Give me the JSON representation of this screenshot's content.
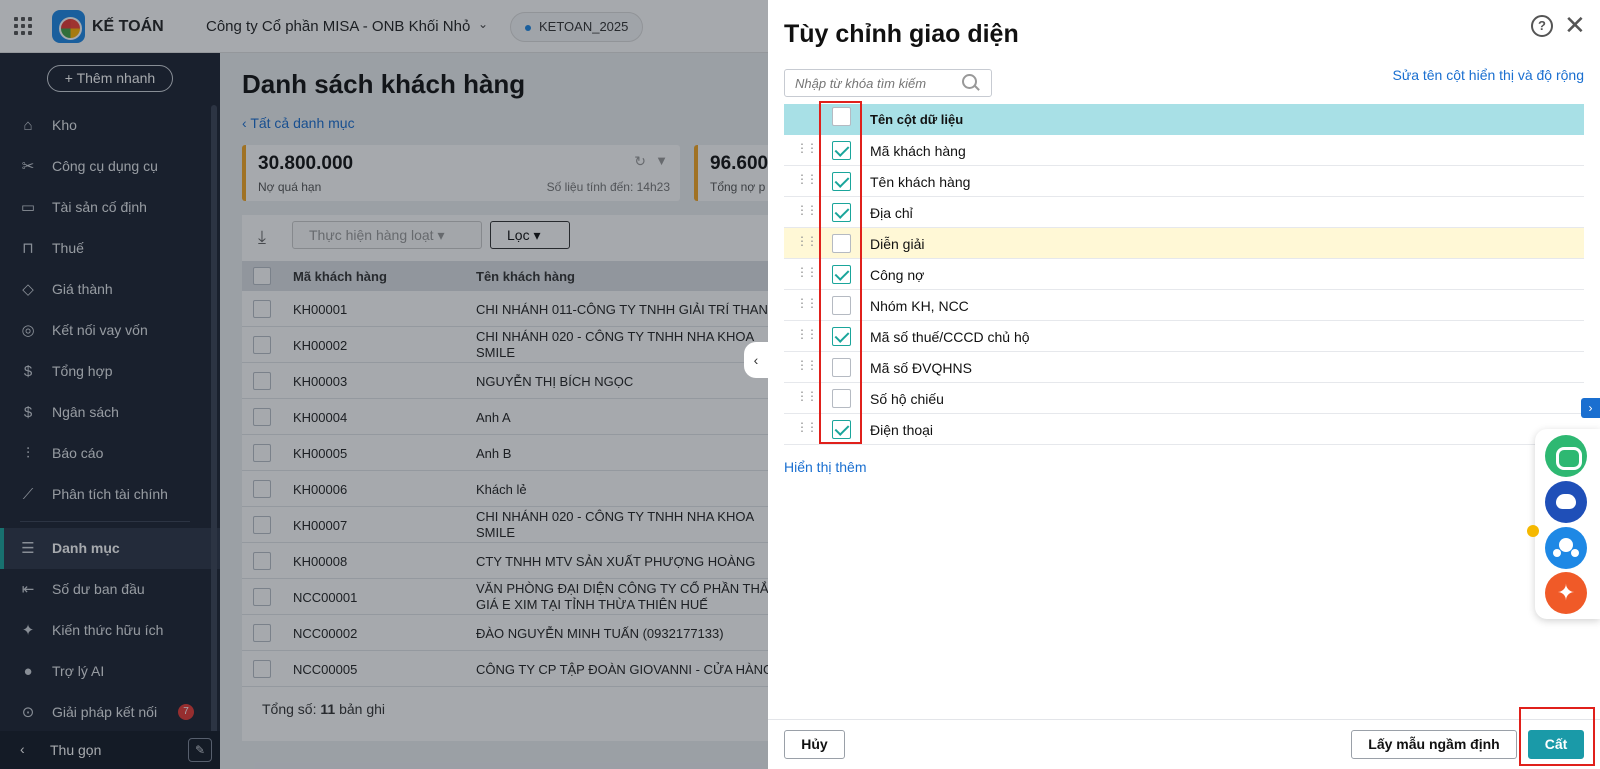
{
  "topbar": {
    "app_name": "KẾ TOÁN",
    "company": "Công ty Cổ phần MISA - ONB Khối Nhỏ",
    "database": "KETOAN_2025"
  },
  "sidebar": {
    "quick_add": "Thêm nhanh",
    "items": [
      {
        "label": "Kho",
        "icon": "warehouse-icon",
        "glyph": "⌂"
      },
      {
        "label": "Công cụ dụng cụ",
        "icon": "tools-icon",
        "glyph": "✂"
      },
      {
        "label": "Tài sản cố định",
        "icon": "car-icon",
        "glyph": "▭"
      },
      {
        "label": "Thuế",
        "icon": "bank-icon",
        "glyph": "⊓"
      },
      {
        "label": "Giá thành",
        "icon": "tag-icon",
        "glyph": "◇"
      },
      {
        "label": "Kết nối vay vốn",
        "icon": "globe-icon",
        "glyph": "◎"
      },
      {
        "label": "Tổng hợp",
        "icon": "ledger-icon",
        "glyph": "$"
      },
      {
        "label": "Ngân sách",
        "icon": "budget-icon",
        "glyph": "$"
      },
      {
        "label": "Báo cáo",
        "icon": "bar-chart-icon",
        "glyph": "⫶"
      },
      {
        "label": "Phân tích tài chính",
        "icon": "line-chart-icon",
        "glyph": "⟋"
      }
    ],
    "items2": [
      {
        "label": "Danh mục",
        "icon": "list-icon",
        "glyph": "☰"
      },
      {
        "label": "Số dư ban đầu",
        "icon": "opening-balance-icon",
        "glyph": "⇤"
      },
      {
        "label": "Kiến thức hữu ích",
        "icon": "knowledge-icon",
        "glyph": "✦"
      },
      {
        "label": "Trợ lý AI",
        "icon": "ai-assistant-icon",
        "glyph": "●"
      },
      {
        "label": "Giải pháp kết nối",
        "icon": "location-icon",
        "glyph": "⊙"
      }
    ],
    "badge": "7",
    "collapse": "Thu gọn"
  },
  "main": {
    "title": "Danh sách khách hàng",
    "back": "Tất cả danh mục",
    "card1": {
      "amount": "30.800.000",
      "label": "Nợ quá hạn",
      "updated": "Số liệu tính đến: 14h23"
    },
    "card2": {
      "amount": "96.600",
      "label": "Tổng nợ p"
    },
    "toolbar": {
      "bulk": "Thực hiện hàng loạt",
      "filter": "Lọc"
    },
    "columns": {
      "code": "Mã khách hàng",
      "name": "Tên khách hàng"
    },
    "rows": [
      {
        "code": "KH00001",
        "name": "CHI NHÁNH 011-CÔNG TY TNHH GIẢI TRÍ THAN"
      },
      {
        "code": "KH00002",
        "name": "CHI NHÁNH 020 - CÔNG TY TNHH NHA KHOA SMILE"
      },
      {
        "code": "KH00003",
        "name": "NGUYỄN THỊ BÍCH NGỌC"
      },
      {
        "code": "KH00004",
        "name": "Anh A"
      },
      {
        "code": "KH00005",
        "name": "Anh B"
      },
      {
        "code": "KH00006",
        "name": "Khách lẻ"
      },
      {
        "code": "KH00007",
        "name": "CHI NHÁNH 020 - CÔNG TY TNHH NHA KHOA SMILE"
      },
      {
        "code": "KH00008",
        "name": "CTY TNHH MTV SẢN XUẤT PHƯỢNG HOÀNG"
      },
      {
        "code": "NCC00001",
        "name": "VĂN PHÒNG ĐẠI DIỆN CÔNG TY CỔ PHẦN THẮ GIÁ E XIM TẠI TỈNH THỪA THIÊN HUẾ"
      },
      {
        "code": "NCC00002",
        "name": "ĐÀO NGUYỄN MINH TUẤN (0932177133)"
      },
      {
        "code": "NCC00005",
        "name": "CÔNG TY CP TẬP ĐOÀN GIOVANNI - CỬA HÀNG"
      }
    ],
    "total_prefix": "Tổng số: ",
    "total_count": "11",
    "total_suffix": " bản ghi"
  },
  "panel": {
    "title": "Tùy chỉnh giao diện",
    "search_placeholder": "Nhập từ khóa tìm kiếm",
    "rename_link": "Sửa tên cột hiển thị và độ rộng",
    "header": "Tên cột dữ liệu",
    "columns": [
      {
        "label": "Mã khách hàng",
        "checked": true
      },
      {
        "label": "Tên khách hàng",
        "checked": true
      },
      {
        "label": "Địa chỉ",
        "checked": true
      },
      {
        "label": "Diễn giải",
        "checked": false,
        "highlight": true
      },
      {
        "label": "Công nợ",
        "checked": true
      },
      {
        "label": "Nhóm KH, NCC",
        "checked": false
      },
      {
        "label": "Mã số thuế/CCCD chủ hộ",
        "checked": true
      },
      {
        "label": "Mã số ĐVQHNS",
        "checked": false
      },
      {
        "label": "Số hộ chiếu",
        "checked": false
      },
      {
        "label": "Điện thoại",
        "checked": true
      }
    ],
    "show_more": "Hiển thị thêm",
    "cancel": "Hủy",
    "default": "Lấy mẫu ngầm định",
    "save": "Cất"
  },
  "colors": {
    "accent": "#1a9aa8",
    "highlight_box": "#e0201b",
    "header_bg": "#a8e0e6",
    "sidebar_bg": "#1c2331"
  }
}
